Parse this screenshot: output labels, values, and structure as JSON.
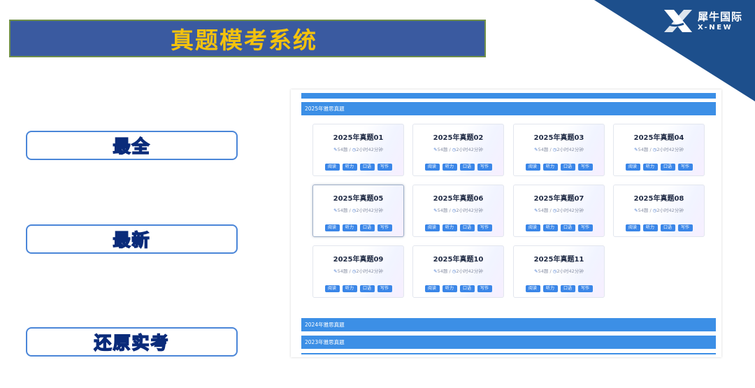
{
  "title": "真题模考系统",
  "logo": {
    "cn": "犀牛国际",
    "en": "X-NEW"
  },
  "features": [
    "最全",
    "最新",
    "还原实考"
  ],
  "panel": {
    "sections": [
      "2025年雅思真题",
      "2024年雅思真题",
      "2023年雅思真题"
    ],
    "cards": [
      {
        "title": "2025年真题01",
        "questions": "54题",
        "duration": "2小时42分钟",
        "tags": [
          "阅读",
          "听力",
          "口语",
          "写作"
        ]
      },
      {
        "title": "2025年真题02",
        "questions": "54题",
        "duration": "2小时42分钟",
        "tags": [
          "阅读",
          "听力",
          "口语",
          "写作"
        ]
      },
      {
        "title": "2025年真题03",
        "questions": "54题",
        "duration": "2小时42分钟",
        "tags": [
          "阅读",
          "听力",
          "口语",
          "写作"
        ]
      },
      {
        "title": "2025年真题04",
        "questions": "54题",
        "duration": "2小时42分钟",
        "tags": [
          "阅读",
          "听力",
          "口语",
          "写作"
        ]
      },
      {
        "title": "2025年真题05",
        "questions": "54题",
        "duration": "2小时42分钟",
        "tags": [
          "阅读",
          "听力",
          "口语",
          "写作"
        ]
      },
      {
        "title": "2025年真题06",
        "questions": "54题",
        "duration": "2小时42分钟",
        "tags": [
          "阅读",
          "听力",
          "口语",
          "写作"
        ]
      },
      {
        "title": "2025年真题07",
        "questions": "54题",
        "duration": "2小时42分钟",
        "tags": [
          "阅读",
          "听力",
          "口语",
          "写作"
        ]
      },
      {
        "title": "2025年真题08",
        "questions": "54题",
        "duration": "2小时42分钟",
        "tags": [
          "阅读",
          "听力",
          "口语",
          "写作"
        ]
      },
      {
        "title": "2025年真题09",
        "questions": "54题",
        "duration": "2小时42分钟",
        "tags": [
          "阅读",
          "听力",
          "口语",
          "写作"
        ]
      },
      {
        "title": "2025年真题10",
        "questions": "54题",
        "duration": "2小时42分钟",
        "tags": [
          "阅读",
          "听力",
          "口语",
          "写作"
        ]
      },
      {
        "title": "2025年真题11",
        "questions": "54题",
        "duration": "2小时42分钟",
        "tags": [
          "阅读",
          "听力",
          "口语",
          "写作"
        ]
      }
    ]
  },
  "colors": {
    "banner": "#3a5aa0",
    "title_text": "#f4c20d",
    "accent_blue": "#3c8fe6",
    "corner": "#1d4f8c"
  }
}
